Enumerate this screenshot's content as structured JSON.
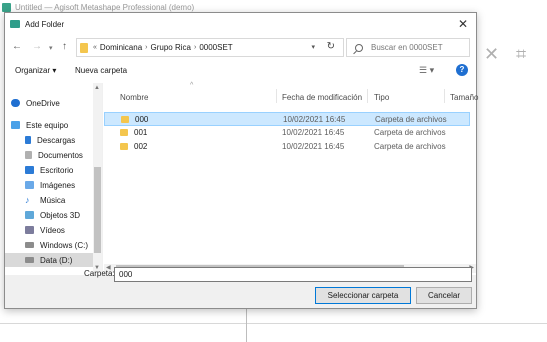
{
  "background_app": {
    "title": "Untitled — Agisoft Metashape Professional (demo)"
  },
  "dialog": {
    "title": "Add Folder",
    "address": {
      "crumbs": [
        "Dominicana",
        "Grupo Rica",
        "0000SET"
      ]
    },
    "search": {
      "placeholder": "Buscar en 0000SET"
    },
    "commands": {
      "organize": "Organizar ▾",
      "new_folder": "Nueva carpeta"
    },
    "nav": {
      "items": [
        {
          "label": "OneDrive",
          "icon": "cloud-icon",
          "color": "#1f6fd1"
        },
        {
          "label": "Este equipo",
          "icon": "computer-icon",
          "color": "#4aa1e8"
        },
        {
          "label": "Descargas",
          "icon": "download-icon",
          "color": "#2c7bd6"
        },
        {
          "label": "Documentos",
          "icon": "document-icon",
          "color": "#8a8a8a"
        },
        {
          "label": "Escritorio",
          "icon": "desktop-icon",
          "color": "#2c7bd6"
        },
        {
          "label": "Imágenes",
          "icon": "pictures-icon",
          "color": "#6aa9e8"
        },
        {
          "label": "Música",
          "icon": "music-icon",
          "color": "#2c7bd6"
        },
        {
          "label": "Objetos 3D",
          "icon": "objects3d-icon",
          "color": "#5fa8d9"
        },
        {
          "label": "Vídeos",
          "icon": "video-icon",
          "color": "#7c7c9c"
        },
        {
          "label": "Windows (C:)",
          "icon": "drive-icon",
          "color": "#8c8c8c"
        },
        {
          "label": "Data (D:)",
          "icon": "drive-icon",
          "color": "#8c8c8c"
        }
      ]
    },
    "columns": {
      "name": "Nombre",
      "date": "Fecha de modificación",
      "type": "Tipo",
      "size": "Tamaño"
    },
    "rows": [
      {
        "name": "000",
        "date": "10/02/2021 16:45",
        "type": "Carpeta de archivos"
      },
      {
        "name": "001",
        "date": "10/02/2021 16:45",
        "type": "Carpeta de archivos"
      },
      {
        "name": "002",
        "date": "10/02/2021 16:45",
        "type": "Carpeta de archivos"
      }
    ],
    "folder_label": "Carpeta:",
    "folder_value": "000",
    "buttons": {
      "select": "Seleccionar carpeta",
      "cancel": "Cancelar"
    }
  }
}
